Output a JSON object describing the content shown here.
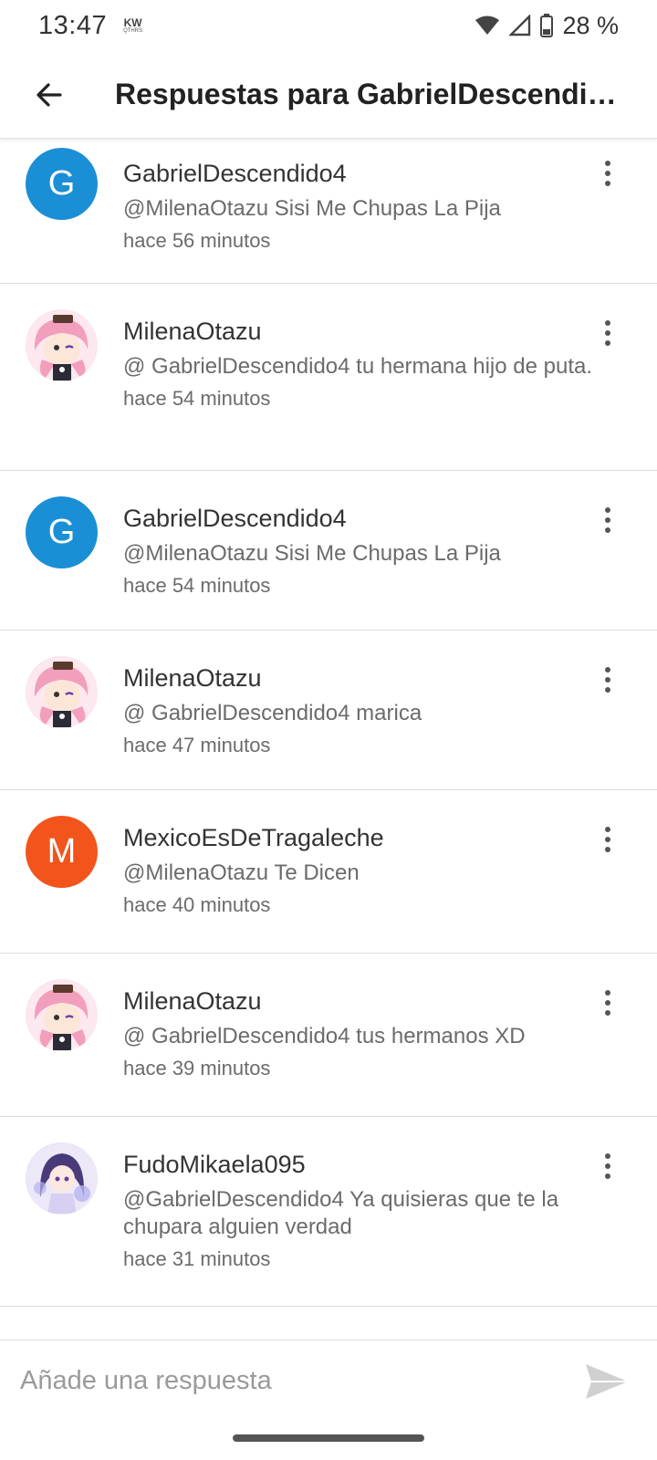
{
  "status_bar": {
    "time": "13:47",
    "carrier_badge": "KW",
    "carrier_badge_sub": "QTHRS",
    "battery": "28 %",
    "icons": [
      "wifi-icon",
      "signal-icon",
      "battery-icon"
    ]
  },
  "app_bar": {
    "title": "Respuestas para GabrielDescendido4",
    "back_icon": "arrow-left-icon"
  },
  "replies": [
    {
      "author": "GabrielDescendido4",
      "text": "@MilenaOtazu Sisi Me Chupas La Pija",
      "time": "hace 56 minutos",
      "avatar_type": "letter",
      "avatar_letter": "G",
      "avatar_color": "#1a8fd6"
    },
    {
      "author": "MilenaOtazu",
      "text": "@ GabrielDescendido4  tu hermana hijo de puta.",
      "time": "hace 54 minutos",
      "avatar_type": "image"
    },
    {
      "author": "GabrielDescendido4",
      "text": "@MilenaOtazu Sisi Me Chupas La Pija",
      "time": "hace 54 minutos",
      "avatar_type": "letter",
      "avatar_letter": "G",
      "avatar_color": "#1a8fd6"
    },
    {
      "author": "MilenaOtazu",
      "text": "@ GabrielDescendido4  marica",
      "time": "hace 47 minutos",
      "avatar_type": "image"
    },
    {
      "author": "MexicoEsDeTragaleche",
      "text": "@MilenaOtazu Te Dicen",
      "time": "hace 40 minutos",
      "avatar_type": "letter",
      "avatar_letter": "M",
      "avatar_color": "#f2541b"
    },
    {
      "author": "MilenaOtazu",
      "text": "@ GabrielDescendido4  tus hermanos XD",
      "time": "hace 39 minutos",
      "avatar_type": "image"
    },
    {
      "author": "FudoMikaela095",
      "text": "@GabrielDescendido4  Ya quisieras que te la chupara alguien verdad",
      "time": "hace 31 minutos",
      "avatar_type": "image-alt"
    }
  ],
  "composer": {
    "placeholder": "Añade una respuesta",
    "send_icon": "send-icon"
  }
}
